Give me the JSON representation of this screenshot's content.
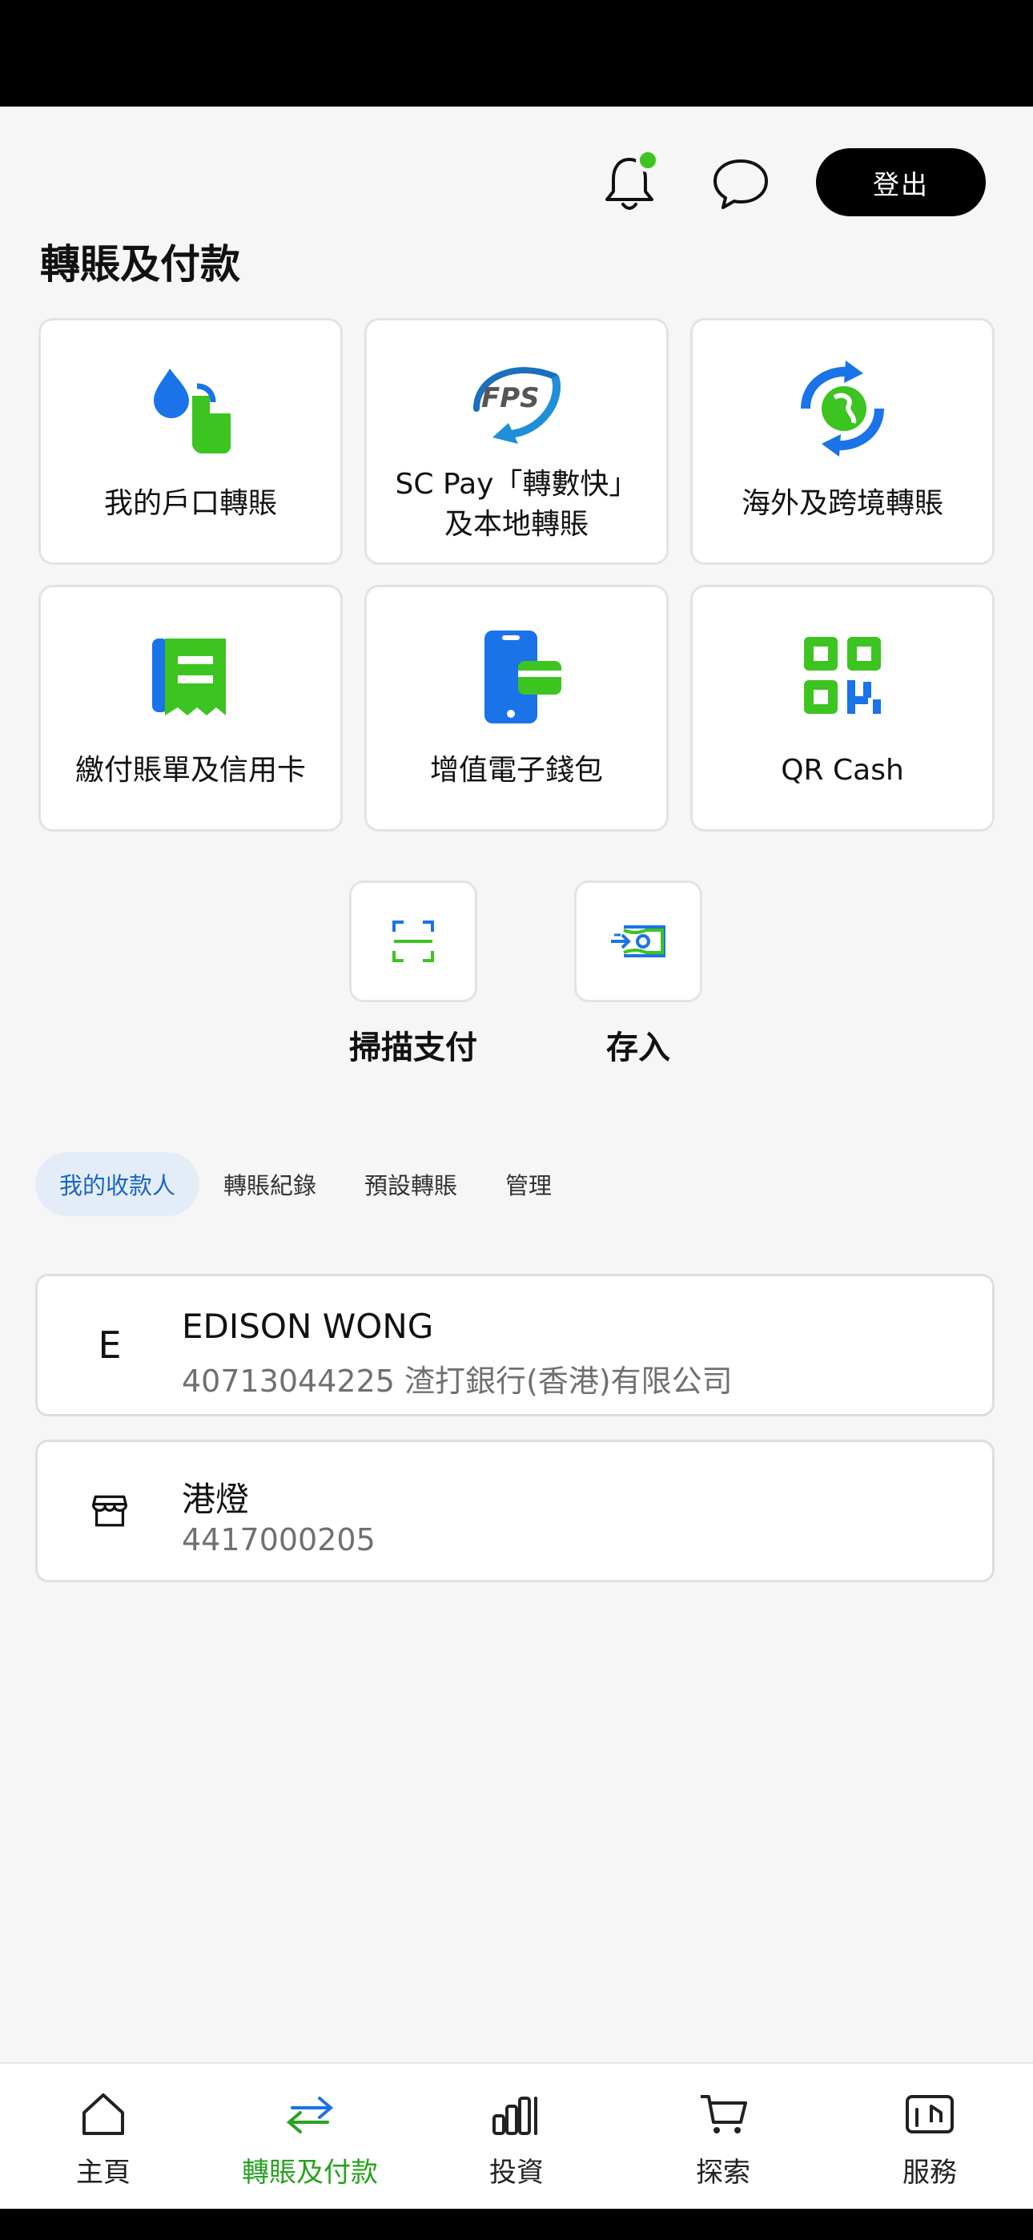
{
  "header": {
    "logout_label": "登出",
    "notification_dot_color": "#3cc421"
  },
  "page_title": "轉賬及付款",
  "tiles": [
    {
      "id": "own-account",
      "icon": "water-drop-transfer-icon",
      "label": "我的戶口轉賬"
    },
    {
      "id": "fps",
      "icon": "fps-logo-icon",
      "label_line1": "SC Pay「轉數快」",
      "label_line2": "及本地轉賬"
    },
    {
      "id": "overseas",
      "icon": "globe-exchange-icon",
      "label": "海外及跨境轉賬"
    },
    {
      "id": "bills",
      "icon": "receipt-icon",
      "label": "繳付賬單及信用卡"
    },
    {
      "id": "ewallet",
      "icon": "phone-card-icon",
      "label": "增值電子錢包"
    },
    {
      "id": "qrcash",
      "icon": "qr-code-icon",
      "label": "QR Cash"
    }
  ],
  "quick_actions": [
    {
      "id": "scan",
      "icon": "scan-icon",
      "label": "掃描支付"
    },
    {
      "id": "deposit",
      "icon": "cash-deposit-icon",
      "label": "存入"
    }
  ],
  "tabs": [
    {
      "label": "我的收款人",
      "active": true
    },
    {
      "label": "轉賬紀錄",
      "active": false
    },
    {
      "label": "預設轉賬",
      "active": false
    },
    {
      "label": "管理",
      "active": false
    }
  ],
  "payees": [
    {
      "avatar": "E",
      "name": "EDISON WONG",
      "detail": "40713044225 渣打銀行(香港)有限公司"
    },
    {
      "avatar_icon": "store-icon",
      "name": "港燈",
      "detail": "4417000205"
    }
  ],
  "bottom_nav": [
    {
      "icon": "home-icon",
      "label": "主頁",
      "active": false
    },
    {
      "icon": "transfer-arrows-icon",
      "label": "轉賬及付款",
      "active": true
    },
    {
      "icon": "bar-chart-icon",
      "label": "投資",
      "active": false
    },
    {
      "icon": "cart-icon",
      "label": "探索",
      "active": false
    },
    {
      "icon": "services-icon",
      "label": "服務",
      "active": false
    }
  ],
  "colors": {
    "brand_blue": "#1a73e8",
    "brand_green": "#3cc421",
    "active_nav_green": "#27a31f"
  }
}
